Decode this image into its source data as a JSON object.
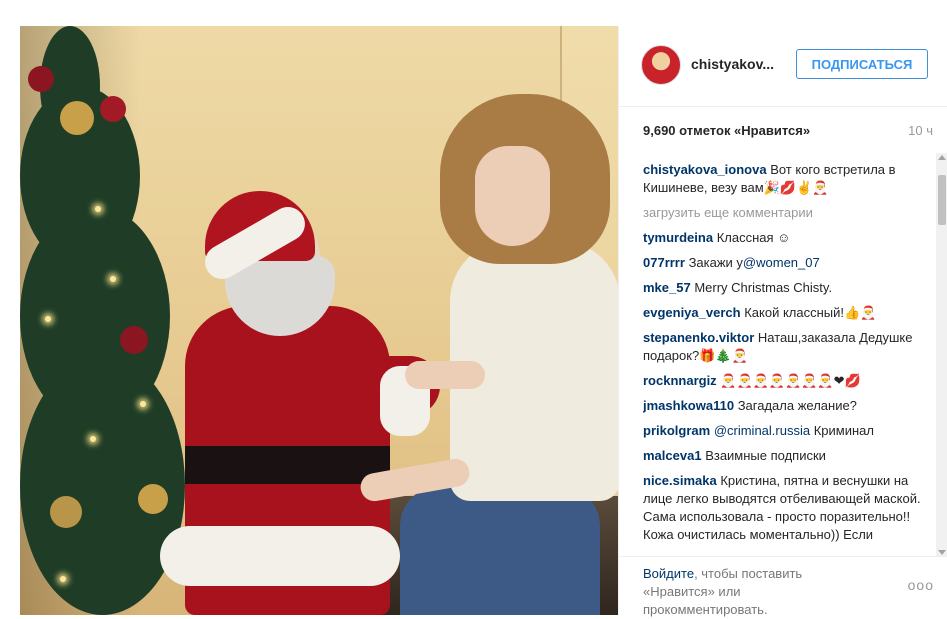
{
  "post": {
    "username": "chistyakov...",
    "follow_label": "ПОДПИСАТЬСЯ",
    "likes": "9,690 отметок «Нравится»",
    "time": "10 ч"
  },
  "comments": {
    "caption_user": "chistyakova_ionova",
    "caption_text": "Вот кого встретила в Кишиневе, везу вам🎉💋✌🎅",
    "load_more": "загрузить еще комментарии",
    "items": [
      {
        "user": "tymurdeina",
        "text": "Классная ☺"
      },
      {
        "user": "077rrrr",
        "text": "Закажи у",
        "mention": "@women_07"
      },
      {
        "user": "mke_57",
        "text": "Merry Christmas Chisty."
      },
      {
        "user": "evgeniya_verch",
        "text": "Какой классный!👍🎅"
      },
      {
        "user": "stepanenko.viktor",
        "text": "Наташ,заказала Дедушке подарок?🎁🎄🎅"
      },
      {
        "user": "rocknnargiz",
        "text": "🎅🎅🎅🎅🎅🎅🎅❤💋"
      },
      {
        "user": "jmashkowa110",
        "text": "Загадала желание?"
      },
      {
        "user": "prikolgram",
        "mention": "@criminal.russia",
        "text": "Криминал"
      },
      {
        "user": "malceva1",
        "text": "Взаимные подписки"
      },
      {
        "user": "nice.simaka",
        "text": "Кристина, пятна и веснушки на лице легко выводятся отбеливающей маской. Сама использовала - просто поразительно!! Кожа очистилась моментально)) Если"
      }
    ]
  },
  "footer": {
    "login_link": "Войдите",
    "text": ", чтобы поставить «Нравится» или прокомментировать.",
    "more_icon": "ooo"
  }
}
